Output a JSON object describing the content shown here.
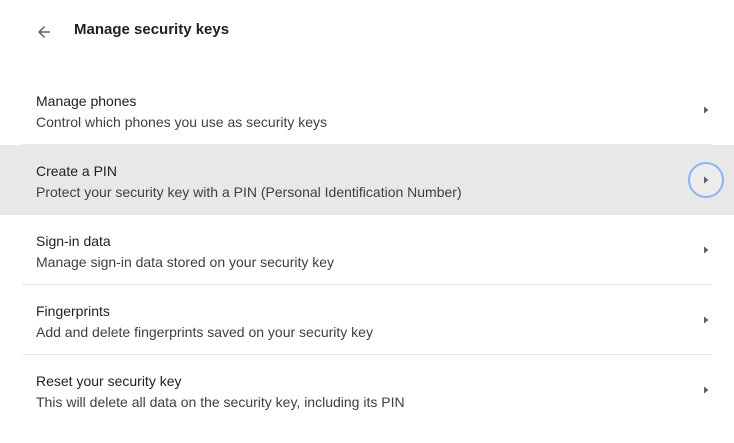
{
  "header": {
    "title": "Manage security keys",
    "back_icon": "arrow-left-icon"
  },
  "items": [
    {
      "title": "Manage phones",
      "subtitle": "Control which phones you use as security keys",
      "icon": "arrow-right-icon"
    },
    {
      "title": "Create a PIN",
      "subtitle": "Protect your security key with a PIN (Personal Identification Number)",
      "icon": "arrow-right-icon",
      "highlighted": true
    },
    {
      "title": "Sign-in data",
      "subtitle": "Manage sign-in data stored on your security key",
      "icon": "arrow-right-icon"
    },
    {
      "title": "Fingerprints",
      "subtitle": "Add and delete fingerprints saved on your security key",
      "icon": "arrow-right-icon"
    },
    {
      "title": "Reset your security key",
      "subtitle": "This will delete all data on the security key, including its PIN",
      "icon": "arrow-right-icon"
    }
  ],
  "colors": {
    "highlight_background": "#e8e8e8",
    "focus_ring": "#8ab4f8",
    "text_primary": "#202124",
    "text_secondary": "#3c4043"
  }
}
